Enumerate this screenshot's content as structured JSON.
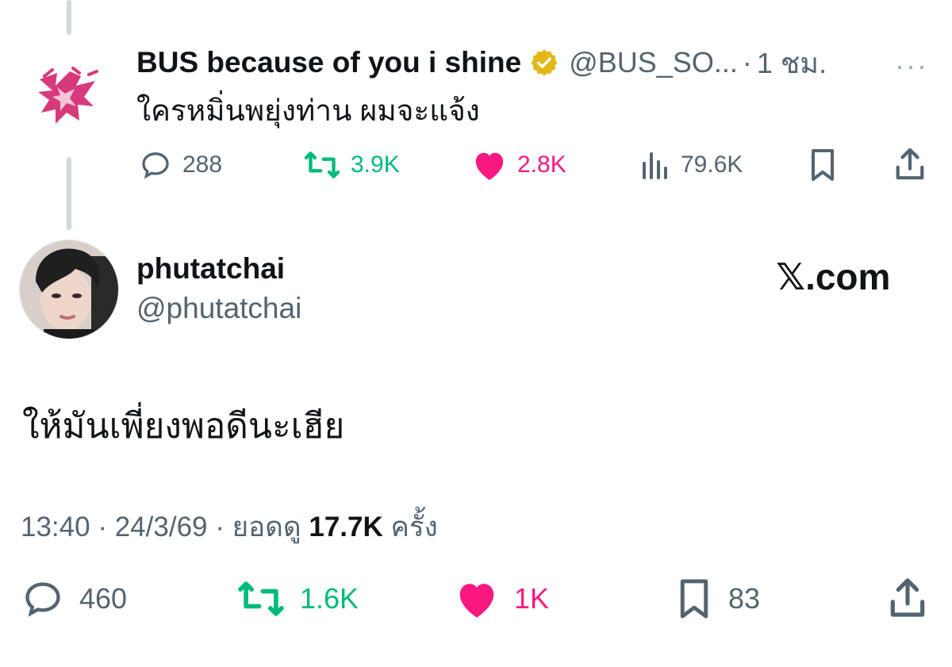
{
  "quoted_tweet": {
    "display_name": "BUS because of you i shine",
    "handle": "@BUS_SO...",
    "separator": "·",
    "time": "1 ชม.",
    "more": "···",
    "text": "ใครหมิ่นพยุ่งท่าน ผมจะแจ้ง",
    "stats": {
      "replies": "288",
      "reposts": "3.9K",
      "likes": "2.8K",
      "views": "79.6K"
    }
  },
  "author": {
    "name": "phutatchai",
    "handle": "@phutatchai"
  },
  "brand": {
    "x_glyph": "𝕏",
    "domain": ".com"
  },
  "tweet": {
    "text": "ให้มันเพี่ยงพอดีนะเฮีย",
    "time": "13:40",
    "date": "24/3/69",
    "views_label": "ยอดดู",
    "views_count": "17.7K",
    "views_unit": "ครั้ง",
    "stats": {
      "replies": "460",
      "reposts": "1.6K",
      "likes": "1K",
      "bookmarks": "83"
    }
  },
  "colors": {
    "text": "#0f1419",
    "secondary": "#536471",
    "repost": "#00ba7c",
    "like": "#f91880",
    "verified": "#e2b719",
    "thread_line": "#cfd9de"
  }
}
